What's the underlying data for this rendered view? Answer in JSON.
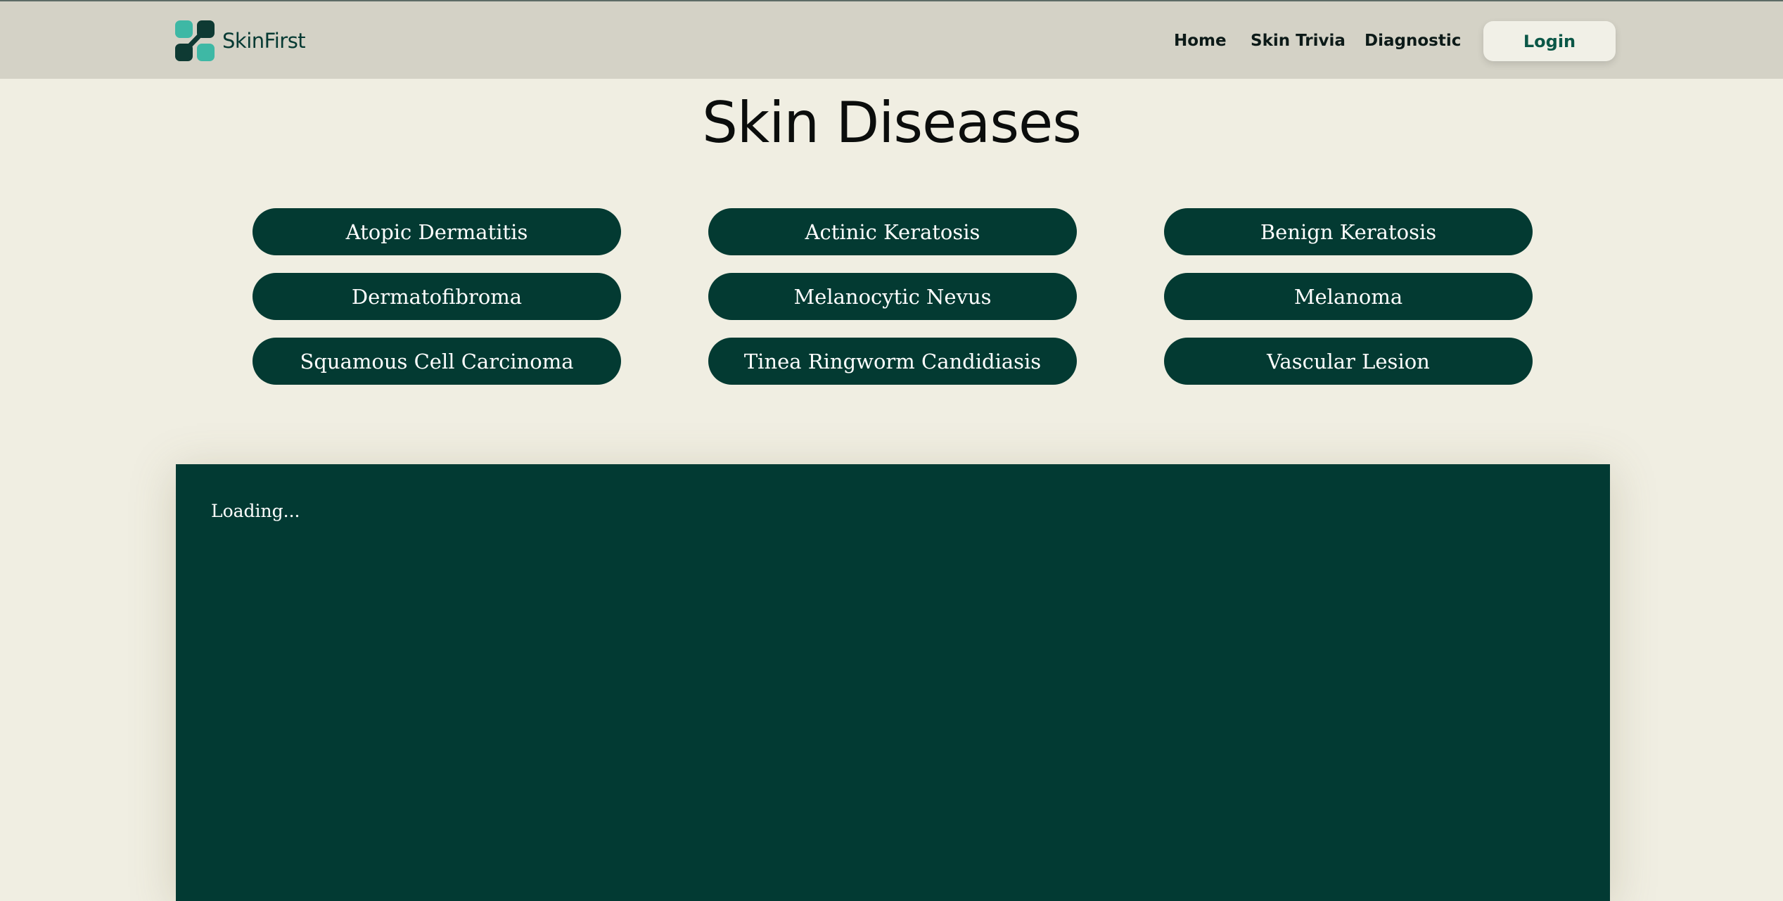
{
  "brand": {
    "name": "SkinFirst",
    "logo_icon": "four-dot-connected-logo-icon",
    "logo_colors": [
      "#3eb8a5",
      "#0e3a33"
    ]
  },
  "nav": {
    "items": [
      {
        "label": "Home"
      },
      {
        "label": "Skin Trivia"
      },
      {
        "label": "Diagnostic"
      }
    ],
    "login_label": "Login"
  },
  "page": {
    "title": "Skin Diseases"
  },
  "diseases": [
    {
      "label": "Atopic Dermatitis"
    },
    {
      "label": "Actinic Keratosis"
    },
    {
      "label": "Benign Keratosis"
    },
    {
      "label": "Dermatofibroma"
    },
    {
      "label": "Melanocytic Nevus"
    },
    {
      "label": "Melanoma"
    },
    {
      "label": "Squamous Cell Carcinoma"
    },
    {
      "label": "Tinea Ringworm Candidiasis"
    },
    {
      "label": "Vascular Lesion"
    }
  ],
  "content": {
    "status_text": "Loading..."
  },
  "colors": {
    "background": "#f0eee2",
    "navbar": "#d4d2c6",
    "primary_dark": "#033a32",
    "accent_teal": "#3eb8a5",
    "login_text": "#0b5747"
  }
}
